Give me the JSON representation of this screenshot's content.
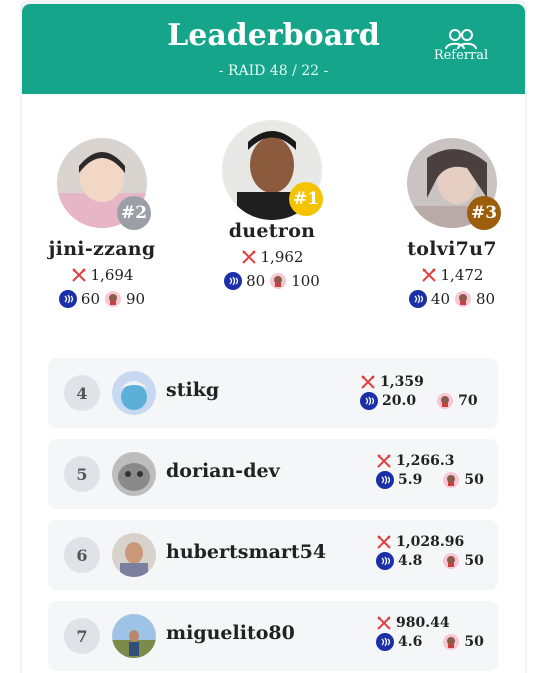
{
  "header": {
    "title": "Leaderboard",
    "subtitle": "- RAID 48 / 22 -",
    "referral_label": "Referral"
  },
  "colors": {
    "primary": "#14a58b",
    "gold": "#f5c400",
    "silver": "#9aa0a6",
    "bronze": "#9c5d0c",
    "coin": "#1a2fa8",
    "sword": "#e04040"
  },
  "podium": [
    {
      "rank": "#2",
      "name": "jini-zzang",
      "score": "1,694",
      "coins": "60",
      "pets": "90"
    },
    {
      "rank": "#1",
      "name": "duetron",
      "score": "1,962",
      "coins": "80",
      "pets": "100"
    },
    {
      "rank": "#3",
      "name": "tolvi7u7",
      "score": "1,472",
      "coins": "40",
      "pets": "80"
    }
  ],
  "rows": [
    {
      "rank": "4",
      "name": "stikg",
      "score": "1,359",
      "coins": "20.0",
      "pets": "70"
    },
    {
      "rank": "5",
      "name": "dorian-dev",
      "score": "1,266.3",
      "coins": "5.9",
      "pets": "50"
    },
    {
      "rank": "6",
      "name": "hubertsmart54",
      "score": "1,028.96",
      "coins": "4.8",
      "pets": "50"
    },
    {
      "rank": "7",
      "name": "miguelito80",
      "score": "980.44",
      "coins": "4.6",
      "pets": "50"
    }
  ]
}
